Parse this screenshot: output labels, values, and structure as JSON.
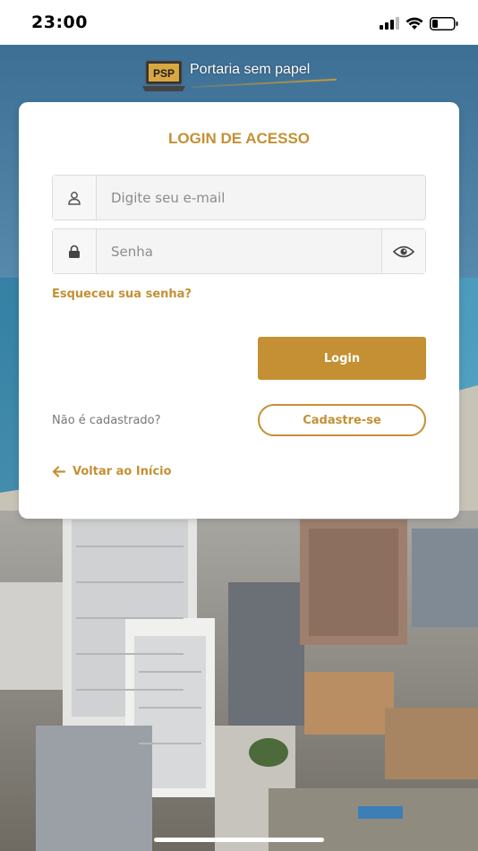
{
  "status_bar": {
    "time": "23:00",
    "icons": [
      "cellular-signal-icon",
      "wifi-icon",
      "battery-icon"
    ]
  },
  "logo": {
    "badge": "PSP",
    "text": "Portaria sem papel"
  },
  "login_card": {
    "title": "LOGIN DE ACESSO",
    "email_placeholder": "Digite seu e-mail",
    "email_value": "",
    "password_placeholder": "Senha",
    "password_value": "",
    "forgot_password": "Esqueceu sua senha?",
    "login_button": "Login",
    "not_registered": "Não é cadastrado?",
    "register_button": "Cadastre-se",
    "back_link": "Voltar ao Início"
  },
  "colors": {
    "accent": "#c49033",
    "card_background": "#ffffff",
    "field_background": "#f4f4f4"
  }
}
